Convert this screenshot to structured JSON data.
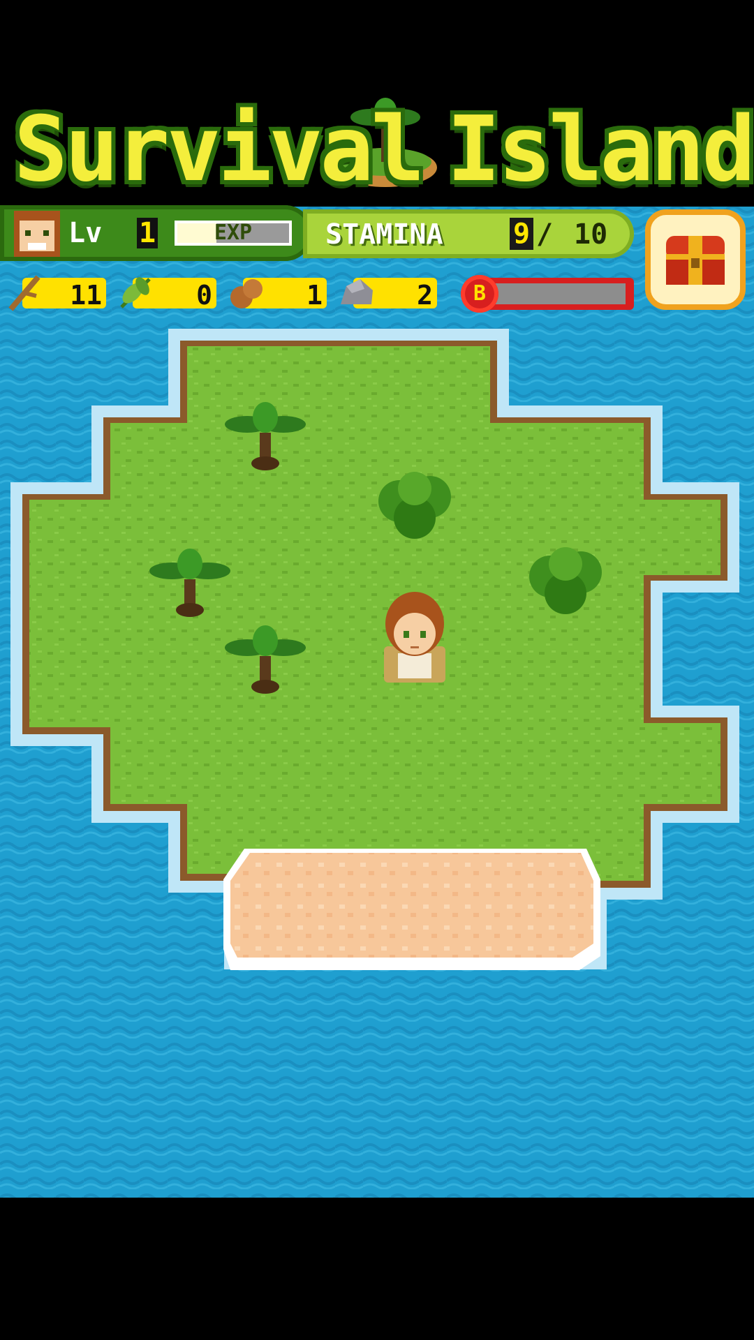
{
  "app": {
    "title_left": "Survival",
    "title_right": "Island"
  },
  "player": {
    "level_label": "Lv",
    "level": "1",
    "exp_label": "EXP",
    "exp_progress": 0.35
  },
  "stamina": {
    "label": "STAMINA",
    "current": "9",
    "separator": "/",
    "max": "10"
  },
  "resources": [
    {
      "icon": "branch-icon",
      "count": "11"
    },
    {
      "icon": "leaf-icon",
      "count": "0"
    },
    {
      "icon": "coconut-icon",
      "count": "1"
    },
    {
      "icon": "stone-icon",
      "count": "2"
    }
  ],
  "special": {
    "badge": "B",
    "progress": 0
  },
  "colors": {
    "ocean": "#1f9fd0",
    "grass": "#7bbf3a",
    "sand": "#f7c79a",
    "cliff": "#7a4a1e",
    "stamina_panel": "#a9d43b",
    "level_panel": "#3d8a1a"
  }
}
